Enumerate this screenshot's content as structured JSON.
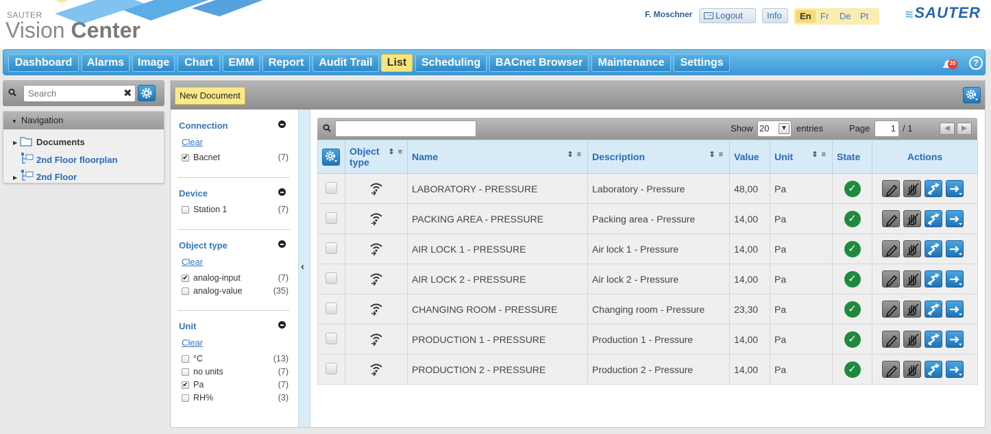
{
  "brand": {
    "small": "SAUTER",
    "title_light": "Vision ",
    "title_bold": "Center",
    "logo": "SAUTER"
  },
  "header": {
    "user": "F. Moschner",
    "logout_label": "Logout",
    "info_label": "Info",
    "languages": [
      "En",
      "Fr",
      "De",
      "Pt"
    ],
    "active_language": "En"
  },
  "nav": {
    "tabs": [
      "Dashboard",
      "Alarms",
      "Image",
      "Chart",
      "EMM",
      "Report",
      "Audit Trail",
      "List",
      "Scheduling",
      "BACnet Browser",
      "Maintenance",
      "Settings"
    ],
    "active_tab": "List",
    "alarm_count": "35",
    "help_label": "?"
  },
  "sidebar": {
    "search_placeholder": "Search",
    "navigation_title": "Navigation",
    "tree": [
      {
        "label": "Documents",
        "icon": "folder-icon"
      },
      {
        "label": "2nd Floor floorplan",
        "icon": "site-tree-icon"
      },
      {
        "label": "2nd Floor",
        "icon": "site-tree-icon"
      }
    ]
  },
  "main": {
    "new_document_label": "New Document"
  },
  "filters": [
    {
      "title": "Connection",
      "clear": "Clear",
      "options": [
        {
          "label": "Bacnet",
          "count": "(7)",
          "checked": true
        }
      ]
    },
    {
      "title": "Device",
      "clear": "",
      "options": [
        {
          "label": "Station 1",
          "count": "(7)",
          "checked": false
        }
      ]
    },
    {
      "title": "Object type",
      "clear": "Clear",
      "options": [
        {
          "label": "analog-input",
          "count": "(7)",
          "checked": true
        },
        {
          "label": "analog-value",
          "count": "(35)",
          "checked": false
        }
      ]
    },
    {
      "title": "Unit",
      "clear": "Clear",
      "options": [
        {
          "label": "°C",
          "count": "(13)",
          "checked": false
        },
        {
          "label": "no units",
          "count": "(7)",
          "checked": false
        },
        {
          "label": "Pa",
          "count": "(7)",
          "checked": true
        },
        {
          "label": "RH%",
          "count": "(3)",
          "checked": false
        }
      ]
    }
  ],
  "table_toolbar": {
    "show_label": "Show",
    "entries_value": "20",
    "entries_label": "entries",
    "page_label": "Page",
    "page_value": "1",
    "page_total": "/ 1"
  },
  "table": {
    "columns": [
      "",
      "Object type",
      "Name",
      "Description",
      "Value",
      "Unit",
      "State",
      "Actions"
    ],
    "rows": [
      {
        "name": "LABORATORY - PRESSURE",
        "description": "Laboratory - Pressure",
        "value": "48,00",
        "unit": "Pa"
      },
      {
        "name": "PACKING AREA - PRESSURE",
        "description": "Packing area - Pressure",
        "value": "14,00",
        "unit": "Pa"
      },
      {
        "name": "AIR LOCK 1 - PRESSURE",
        "description": "Air lock 1 - Pressure",
        "value": "14,00",
        "unit": "Pa"
      },
      {
        "name": "AIR LOCK 2 - PRESSURE",
        "description": "Air lock 2 - Pressure",
        "value": "14,00",
        "unit": "Pa"
      },
      {
        "name": "CHANGING ROOM - PRESSURE",
        "description": "Changing room - Pressure",
        "value": "23,30",
        "unit": "Pa"
      },
      {
        "name": "PRODUCTION 1 - PRESSURE",
        "description": "Production 1 - Pressure",
        "value": "14,00",
        "unit": "Pa"
      },
      {
        "name": "PRODUCTION 2 - PRESSURE",
        "description": "Production 2 - Pressure",
        "value": "14,00",
        "unit": "Pa"
      }
    ]
  },
  "colors": {
    "accent_blue": "#2a6ab4",
    "active_yellow": "#fae57a",
    "state_ok": "#1f8a3e"
  }
}
